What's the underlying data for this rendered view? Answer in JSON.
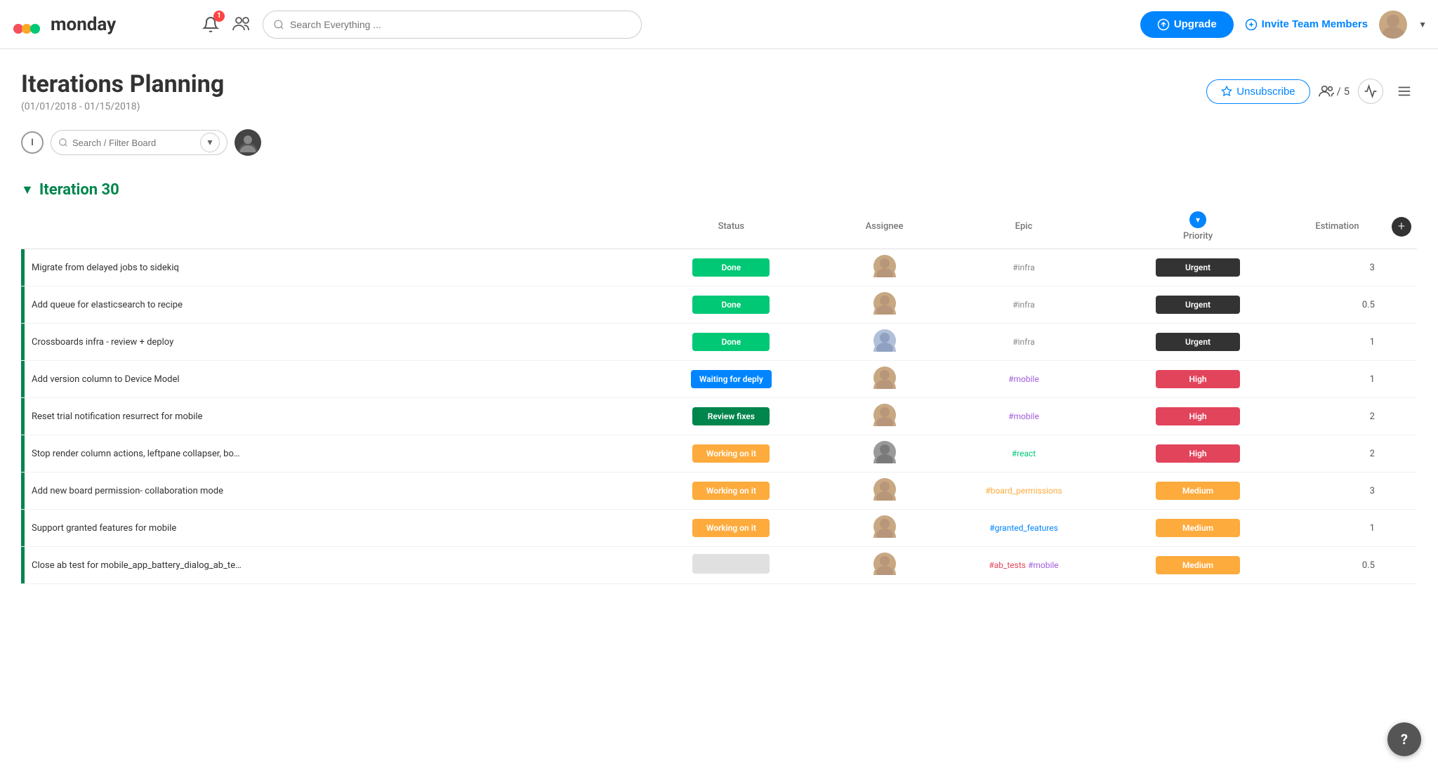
{
  "header": {
    "logo_text": "monday",
    "search_placeholder": "Search Everything ...",
    "notif_badge": "1",
    "upgrade_label": "Upgrade",
    "invite_label": "Invite Team Members"
  },
  "board": {
    "title": "Iterations Planning",
    "subtitle": "(01/01/2018 - 01/15/2018)",
    "unsubscribe_label": "Unsubscribe",
    "members_count": "/ 5"
  },
  "toolbar": {
    "filter_placeholder": "Search / Filter Board"
  },
  "group": {
    "name": "Iteration 30",
    "columns": {
      "status": "Status",
      "assignee": "Assignee",
      "epic": "Epic",
      "priority": "Priority",
      "estimation": "Estimation"
    },
    "rows": [
      {
        "name": "Migrate from delayed jobs to sidekiq",
        "status": "Done",
        "status_class": "status-done",
        "epic": "#infra",
        "epic_class": "epic-infra",
        "priority": "Urgent",
        "priority_class": "priority-urgent",
        "estimation": "3",
        "avatar_color": "#c8a882",
        "avatar_letter": "A"
      },
      {
        "name": "Add queue for elasticsearch to recipe",
        "status": "Done",
        "status_class": "status-done",
        "epic": "#infra",
        "epic_class": "epic-infra",
        "priority": "Urgent",
        "priority_class": "priority-urgent",
        "estimation": "0.5",
        "avatar_color": "#c8a882",
        "avatar_letter": "A"
      },
      {
        "name": "Crossboards infra - review + deploy",
        "status": "Done",
        "status_class": "status-done",
        "epic": "#infra",
        "epic_class": "epic-infra",
        "priority": "Urgent",
        "priority_class": "priority-urgent",
        "estimation": "1",
        "avatar_color": "#b0c0d8",
        "avatar_letter": "B"
      },
      {
        "name": "Add version column to Device Model",
        "status": "Waiting for deply",
        "status_class": "status-waiting",
        "epic": "#mobile",
        "epic_class": "epic-mobile",
        "priority": "High",
        "priority_class": "priority-high",
        "estimation": "1",
        "avatar_color": "#c8a882",
        "avatar_letter": "A"
      },
      {
        "name": "Reset trial notification resurrect for mobile",
        "status": "Review fixes",
        "status_class": "status-review",
        "epic": "#mobile",
        "epic_class": "epic-mobile",
        "priority": "High",
        "priority_class": "priority-high",
        "estimation": "2",
        "avatar_color": "#c8a882",
        "avatar_letter": "A"
      },
      {
        "name": "Stop render column actions, leftpane collapser, bo…",
        "status": "Working on it",
        "status_class": "status-working",
        "epic": "#react",
        "epic_class": "epic-react",
        "priority": "High",
        "priority_class": "priority-high",
        "estimation": "2",
        "avatar_color": "#888",
        "avatar_letter": "C"
      },
      {
        "name": "Add new board permission- collaboration mode",
        "status": "Working on it",
        "status_class": "status-working",
        "epic": "#board_permissions",
        "epic_class": "epic-board",
        "priority": "Medium",
        "priority_class": "priority-medium",
        "estimation": "3",
        "avatar_color": "#c8a882",
        "avatar_letter": "A"
      },
      {
        "name": "Support granted features for mobile",
        "status": "Working on it",
        "status_class": "status-working",
        "epic": "#granted_features",
        "epic_class": "epic-granted",
        "priority": "Medium",
        "priority_class": "priority-medium",
        "estimation": "1",
        "avatar_color": "#c8a882",
        "avatar_letter": "A"
      },
      {
        "name": "Close ab test for mobile_app_battery_dialog_ab_te…",
        "status": "",
        "status_class": "status-empty",
        "epic": "#ab_tests #mobile",
        "epic_class": "epic-abtests",
        "priority": "Medium",
        "priority_class": "priority-medium",
        "estimation": "0.5",
        "avatar_color": "#c8a882",
        "avatar_letter": "A"
      }
    ]
  },
  "help": "?"
}
